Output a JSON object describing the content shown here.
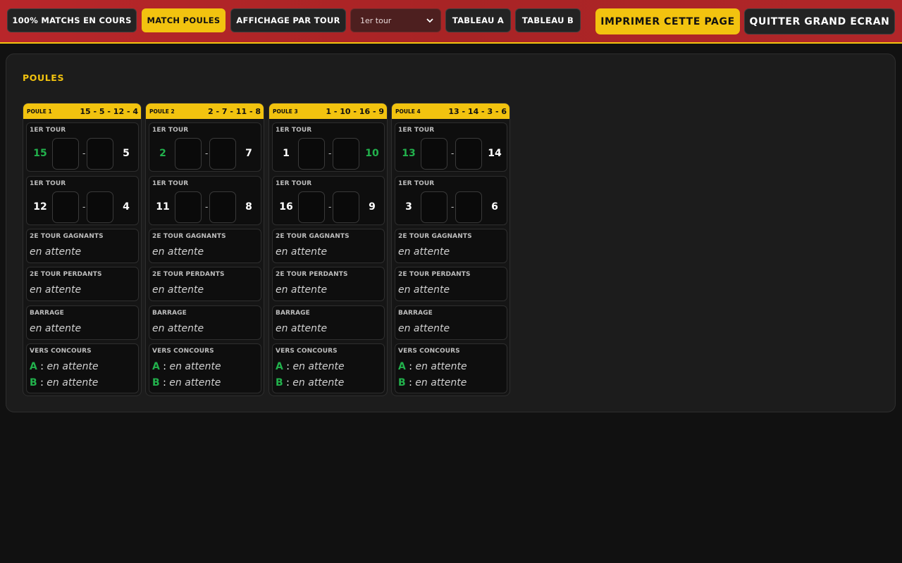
{
  "toolbar": {
    "btn_matchs": "100% MATCHS EN COURS",
    "btn_poules": "MATCH POULES",
    "btn_affichage": "AFFICHAGE PAR TOUR",
    "tour_select_value": "1er tour",
    "btn_tableau_a": "TABLEAU A",
    "btn_tableau_b": "TABLEAU B",
    "btn_imprimer": "IMPRIMER CETTE PAGE",
    "btn_quitter": "QUITTER GRAND ECRAN"
  },
  "section_title": "POULES",
  "poules": [
    {
      "name": "POULE 1",
      "teams": "15 - 5 - 12 - 4",
      "matches": [
        {
          "label": "1ER TOUR",
          "left": "15",
          "right": "5",
          "winner": "left"
        },
        {
          "label": "1ER TOUR",
          "left": "12",
          "right": "4",
          "winner": ""
        }
      ],
      "g2": {
        "label": "2E TOUR GAGNANTS",
        "value": "en attente"
      },
      "p2": {
        "label": "2E TOUR PERDANTS",
        "value": "en attente"
      },
      "barrage": {
        "label": "BARRAGE",
        "value": "en attente"
      },
      "concours": {
        "label": "VERS CONCOURS",
        "a_letter": "A",
        "a_value": "en attente",
        "b_letter": "B",
        "b_value": "en attente"
      }
    },
    {
      "name": "POULE 2",
      "teams": "2 - 7 - 11 - 8",
      "matches": [
        {
          "label": "1ER TOUR",
          "left": "2",
          "right": "7",
          "winner": "left"
        },
        {
          "label": "1ER TOUR",
          "left": "11",
          "right": "8",
          "winner": ""
        }
      ],
      "g2": {
        "label": "2E TOUR GAGNANTS",
        "value": "en attente"
      },
      "p2": {
        "label": "2E TOUR PERDANTS",
        "value": "en attente"
      },
      "barrage": {
        "label": "BARRAGE",
        "value": "en attente"
      },
      "concours": {
        "label": "VERS CONCOURS",
        "a_letter": "A",
        "a_value": "en attente",
        "b_letter": "B",
        "b_value": "en attente"
      }
    },
    {
      "name": "POULE 3",
      "teams": "1 - 10 - 16 - 9",
      "matches": [
        {
          "label": "1ER TOUR",
          "left": "1",
          "right": "10",
          "winner": "right"
        },
        {
          "label": "1ER TOUR",
          "left": "16",
          "right": "9",
          "winner": ""
        }
      ],
      "g2": {
        "label": "2E TOUR GAGNANTS",
        "value": "en attente"
      },
      "p2": {
        "label": "2E TOUR PERDANTS",
        "value": "en attente"
      },
      "barrage": {
        "label": "BARRAGE",
        "value": "en attente"
      },
      "concours": {
        "label": "VERS CONCOURS",
        "a_letter": "A",
        "a_value": "en attente",
        "b_letter": "B",
        "b_value": "en attente"
      }
    },
    {
      "name": "POULE 4",
      "teams": "13 - 14 - 3 - 6",
      "matches": [
        {
          "label": "1ER TOUR",
          "left": "13",
          "right": "14",
          "winner": "left"
        },
        {
          "label": "1ER TOUR",
          "left": "3",
          "right": "6",
          "winner": ""
        }
      ],
      "g2": {
        "label": "2E TOUR GAGNANTS",
        "value": "en attente"
      },
      "p2": {
        "label": "2E TOUR PERDANTS",
        "value": "en attente"
      },
      "barrage": {
        "label": "BARRAGE",
        "value": "en attente"
      },
      "concours": {
        "label": "VERS CONCOURS",
        "a_letter": "A",
        "a_value": "en attente",
        "b_letter": "B",
        "b_value": "en attente"
      }
    }
  ],
  "colors": {
    "accent_yellow": "#f2c30f",
    "header_red": "#b12629",
    "winner_green": "#22b14c",
    "background": "#111111"
  }
}
